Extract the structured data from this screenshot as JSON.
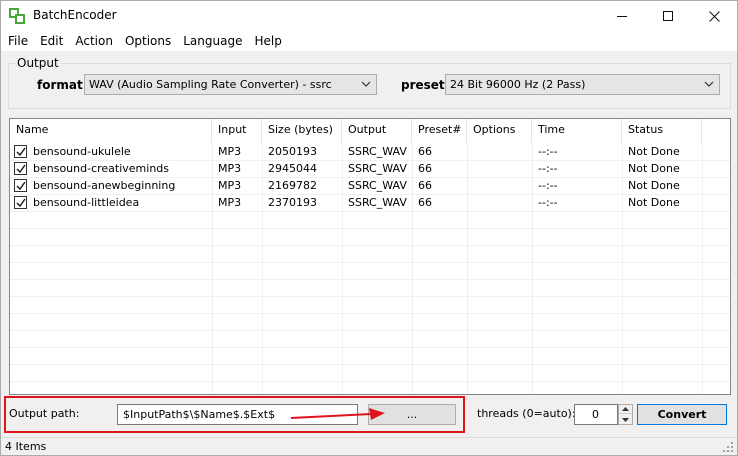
{
  "window": {
    "title": "BatchEncoder"
  },
  "menu": [
    "File",
    "Edit",
    "Action",
    "Options",
    "Language",
    "Help"
  ],
  "output_group": {
    "legend": "Output",
    "format_label": "format:",
    "format_value": "WAV (Audio Sampling Rate Converter) - ssrc",
    "preset_label": "preset:",
    "preset_value": "24 Bit 96000 Hz (2 Pass)"
  },
  "list": {
    "columns": [
      "Name",
      "Input",
      "Size (bytes)",
      "Output",
      "Preset#",
      "Options",
      "Time",
      "Status"
    ],
    "rows": [
      {
        "checked": true,
        "name": "bensound-ukulele",
        "input": "MP3",
        "size": "2050193",
        "output": "SSRC_WAV",
        "preset": "66",
        "options": "",
        "time": "--:--",
        "status": "Not Done"
      },
      {
        "checked": true,
        "name": "bensound-creativeminds",
        "input": "MP3",
        "size": "2945044",
        "output": "SSRC_WAV",
        "preset": "66",
        "options": "",
        "time": "--:--",
        "status": "Not Done"
      },
      {
        "checked": true,
        "name": "bensound-anewbeginning",
        "input": "MP3",
        "size": "2169782",
        "output": "SSRC_WAV",
        "preset": "66",
        "options": "",
        "time": "--:--",
        "status": "Not Done"
      },
      {
        "checked": true,
        "name": "bensound-littleidea",
        "input": "MP3",
        "size": "2370193",
        "output": "SSRC_WAV",
        "preset": "66",
        "options": "",
        "time": "--:--",
        "status": "Not Done"
      }
    ]
  },
  "bottom": {
    "output_path_label": "Output path:",
    "output_path_value": "$InputPath$\\$Name$.$Ext$",
    "browse_label": "...",
    "threads_label": "threads (0=auto):",
    "threads_value": "0",
    "convert_label": "Convert"
  },
  "status": {
    "text": "4 Items"
  },
  "colors": {
    "highlight_frame": "#e0141e",
    "annotation_arrow": "#e0141e"
  }
}
